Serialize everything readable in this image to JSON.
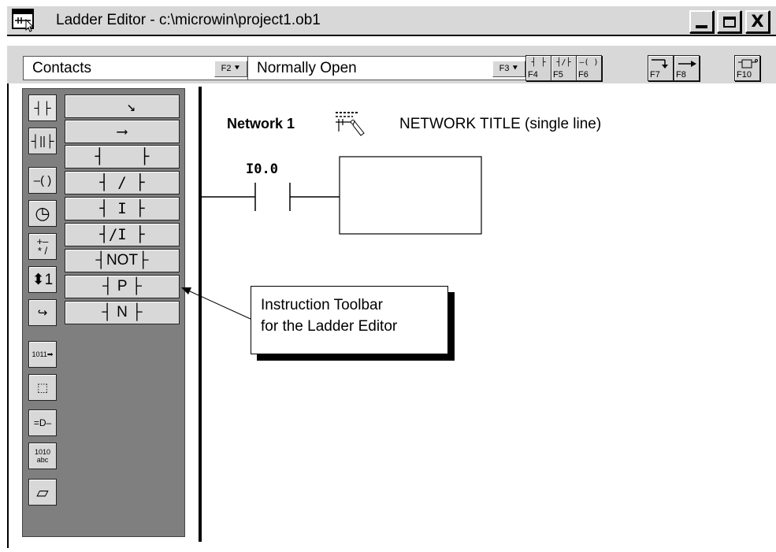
{
  "window": {
    "title": "Ladder Editor - c:\\microwin\\project1.ob1",
    "minimize_icon": "minimize-icon",
    "maximize_icon": "maximize-icon",
    "close_label": "X"
  },
  "toolbar": {
    "category_combo": {
      "value": "Contacts",
      "key": "F2"
    },
    "type_combo": {
      "value": "Normally Open",
      "key": "F3"
    },
    "buttons": [
      {
        "glyph": "┤ ├",
        "key": "F4",
        "icon": "normally-open-contact-icon"
      },
      {
        "glyph": "┤/├",
        "key": "F5",
        "icon": "normally-closed-contact-icon"
      },
      {
        "glyph": "–( )",
        "key": "F6",
        "icon": "coil-icon"
      },
      {
        "glyph": "",
        "key": "F7",
        "icon": "vertical-line-icon"
      },
      {
        "glyph": "",
        "key": "F8",
        "icon": "horizontal-line-icon"
      },
      {
        "glyph": "",
        "key": "F10",
        "icon": "box-icon"
      }
    ]
  },
  "palette": {
    "categories": [
      {
        "icon": "contacts-icon",
        "glyph": "┤├"
      },
      {
        "icon": "contacts-compare-icon",
        "glyph": "┤||├"
      },
      {
        "icon": "coils-icon",
        "glyph": "–( )"
      },
      {
        "icon": "timer-icon",
        "glyph": "◷"
      },
      {
        "icon": "math-icon",
        "glyph": "+–\n* /"
      },
      {
        "icon": "increment-icon",
        "glyph": "⬍1"
      },
      {
        "icon": "move-icon",
        "glyph": "↪"
      },
      {
        "icon": "shift-icon",
        "glyph": "1011➡"
      },
      {
        "icon": "program-control-icon",
        "glyph": "⬚"
      },
      {
        "icon": "logic-icon",
        "glyph": "=D–"
      },
      {
        "icon": "conversion-icon",
        "glyph": "1010 abc"
      },
      {
        "icon": "communication-icon",
        "glyph": "▱"
      }
    ],
    "instructions": [
      {
        "label": "  ↘",
        "icon": "branch-down-icon"
      },
      {
        "label": "⟶",
        "icon": "line-right-icon"
      },
      {
        "label": "┤    ├",
        "icon": "normally-open-contact-icon"
      },
      {
        "label": "┤ / ├",
        "icon": "normally-closed-contact-icon"
      },
      {
        "label": "┤ I ├",
        "icon": "immediate-open-contact-icon"
      },
      {
        "label": "┤/I ├",
        "icon": "immediate-closed-contact-icon"
      },
      {
        "label": "┤NOT├",
        "icon": "not-contact-icon"
      },
      {
        "label": "┤ P ├",
        "icon": "positive-transition-icon"
      },
      {
        "label": "┤ N ├",
        "icon": "negative-transition-icon"
      }
    ]
  },
  "editor": {
    "network_label": "Network 1",
    "network_title": "NETWORK TITLE (single line)",
    "contact_address": "I0.0"
  },
  "callout": {
    "line1": "Instruction Toolbar",
    "line2": "for the Ladder Editor"
  }
}
